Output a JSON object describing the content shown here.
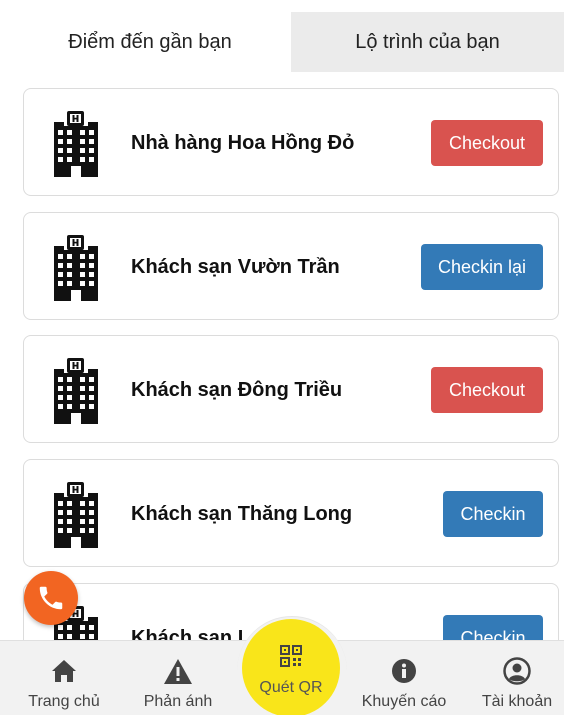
{
  "tabs": [
    {
      "label": "Điểm đến gần bạn",
      "active": true
    },
    {
      "label": "Lộ trình của bạn",
      "active": false
    }
  ],
  "places": [
    {
      "name": "Nhà hàng Hoa Hồng Đỏ",
      "action": "Checkout",
      "action_color": "#d9534f",
      "icon": "hotel-icon"
    },
    {
      "name": "Khách sạn Vườn Trần",
      "action": "Checkin lại",
      "action_color": "#337ab7",
      "icon": "hotel-icon"
    },
    {
      "name": "Khách sạn Đông Triều",
      "action": "Checkout",
      "action_color": "#d9534f",
      "icon": "hotel-icon"
    },
    {
      "name": "Khách sạn Thăng Long",
      "action": "Checkin",
      "action_color": "#337ab7",
      "icon": "hotel-icon"
    },
    {
      "name": "Khách sạn L",
      "action": "Checkin",
      "action_color": "#337ab7",
      "icon": "hotel-icon"
    }
  ],
  "floating_call": {
    "icon": "phone-icon",
    "color": "#f26522"
  },
  "bottom_nav": {
    "home": {
      "label": "Trang chủ",
      "icon": "home-icon"
    },
    "feedback": {
      "label": "Phản ánh",
      "icon": "warning-icon"
    },
    "qr": {
      "label": "Quét QR",
      "icon": "qr-icon",
      "color": "#f9e51a"
    },
    "advisory": {
      "label": "Khuyến cáo",
      "icon": "info-icon"
    },
    "account": {
      "label": "Tài khoản",
      "icon": "user-icon"
    }
  }
}
